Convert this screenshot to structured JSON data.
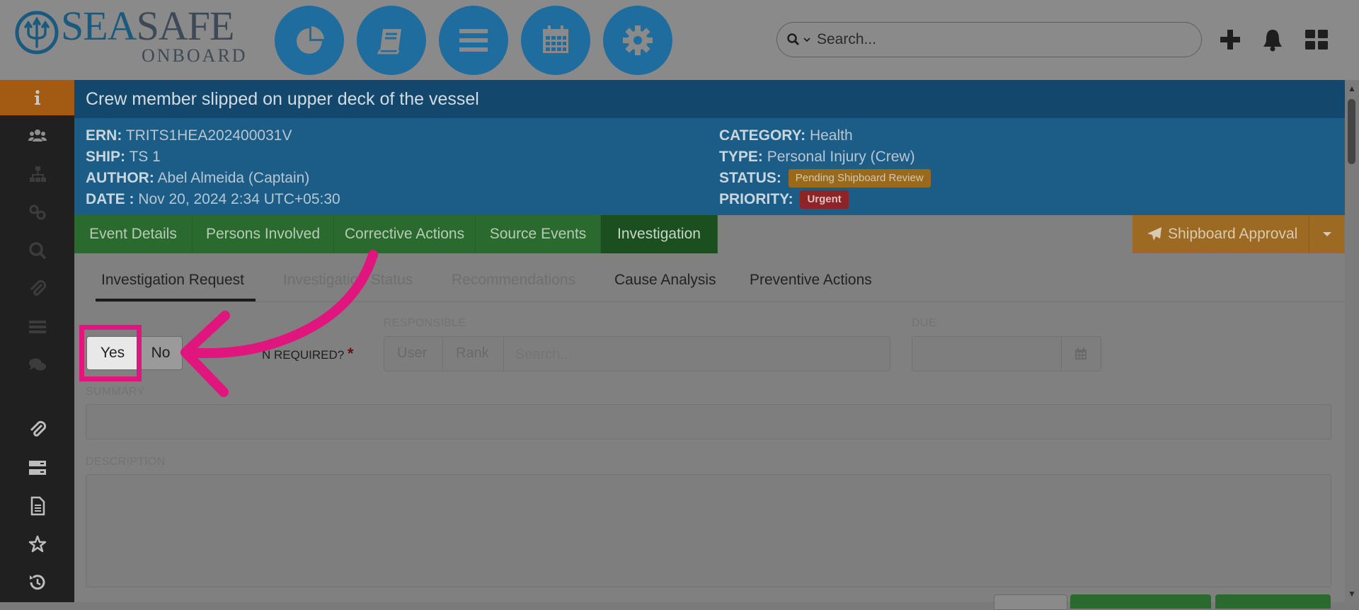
{
  "brand": {
    "word_sea": "SEA",
    "word_safe": "SAFE",
    "word_onboard": "ONBOARD"
  },
  "header": {
    "nav_icons": [
      "pie-chart-icon",
      "book-icon",
      "menu-bars-icon",
      "calendar-icon",
      "gear-icon"
    ],
    "search_placeholder": "Search...",
    "right_icons": [
      "plus-icon",
      "bell-icon",
      "grid-icon"
    ]
  },
  "sidebar": {
    "icons": [
      "info-icon",
      "users-icon",
      "sitemap-icon",
      "link-icon",
      "search-icon",
      "paperclip-icon",
      "list-icon",
      "comments-icon",
      "paperclip-icon",
      "server-icon",
      "document-icon",
      "star-icon",
      "history-icon"
    ]
  },
  "event": {
    "title": "Crew member slipped on upper deck of the vessel",
    "ern_label": "ERN:",
    "ern": "TRITS1HEA202400031V",
    "ship_label": "SHIP:",
    "ship": "TS 1",
    "author_label": "AUTHOR:",
    "author": "Abel Almeida (Captain)",
    "date_label": "DATE :",
    "date": "Nov 20, 2024 2:34 UTC+05:30",
    "category_label": "CATEGORY:",
    "category": "Health",
    "type_label": "TYPE:",
    "type": "Personal Injury (Crew)",
    "status_label": "STATUS:",
    "status": "Pending Shipboard Review",
    "priority_label": "PRIORITY:",
    "priority": "Urgent"
  },
  "tabs": {
    "main": [
      "Event Details",
      "Persons Involved",
      "Corrective Actions",
      "Source Events",
      "Investigation"
    ],
    "active": "Investigation",
    "approval_label": "Shipboard Approval"
  },
  "subtabs": {
    "items": [
      "Investigation Request",
      "Investigation Status",
      "Recommendations",
      "Cause Analysis",
      "Preventive Actions"
    ],
    "active": "Investigation Request"
  },
  "form": {
    "yes_label": "Yes",
    "no_label": "No",
    "required_label": "N REQUIRED?",
    "required_marker": "*",
    "responsible_label": "RESPONSIBLE",
    "responsible_user": "User",
    "responsible_rank": "Rank",
    "responsible_placeholder": "Search...",
    "due_label": "DUE",
    "summary_label": "SUMMARY",
    "description_label": "DESCRIPTION"
  },
  "colors": {
    "highlight": "#e0157d",
    "nav_blue": "#1f6d9e",
    "tab_green": "#2b6a2e",
    "approval_orange": "#9c6a22"
  }
}
